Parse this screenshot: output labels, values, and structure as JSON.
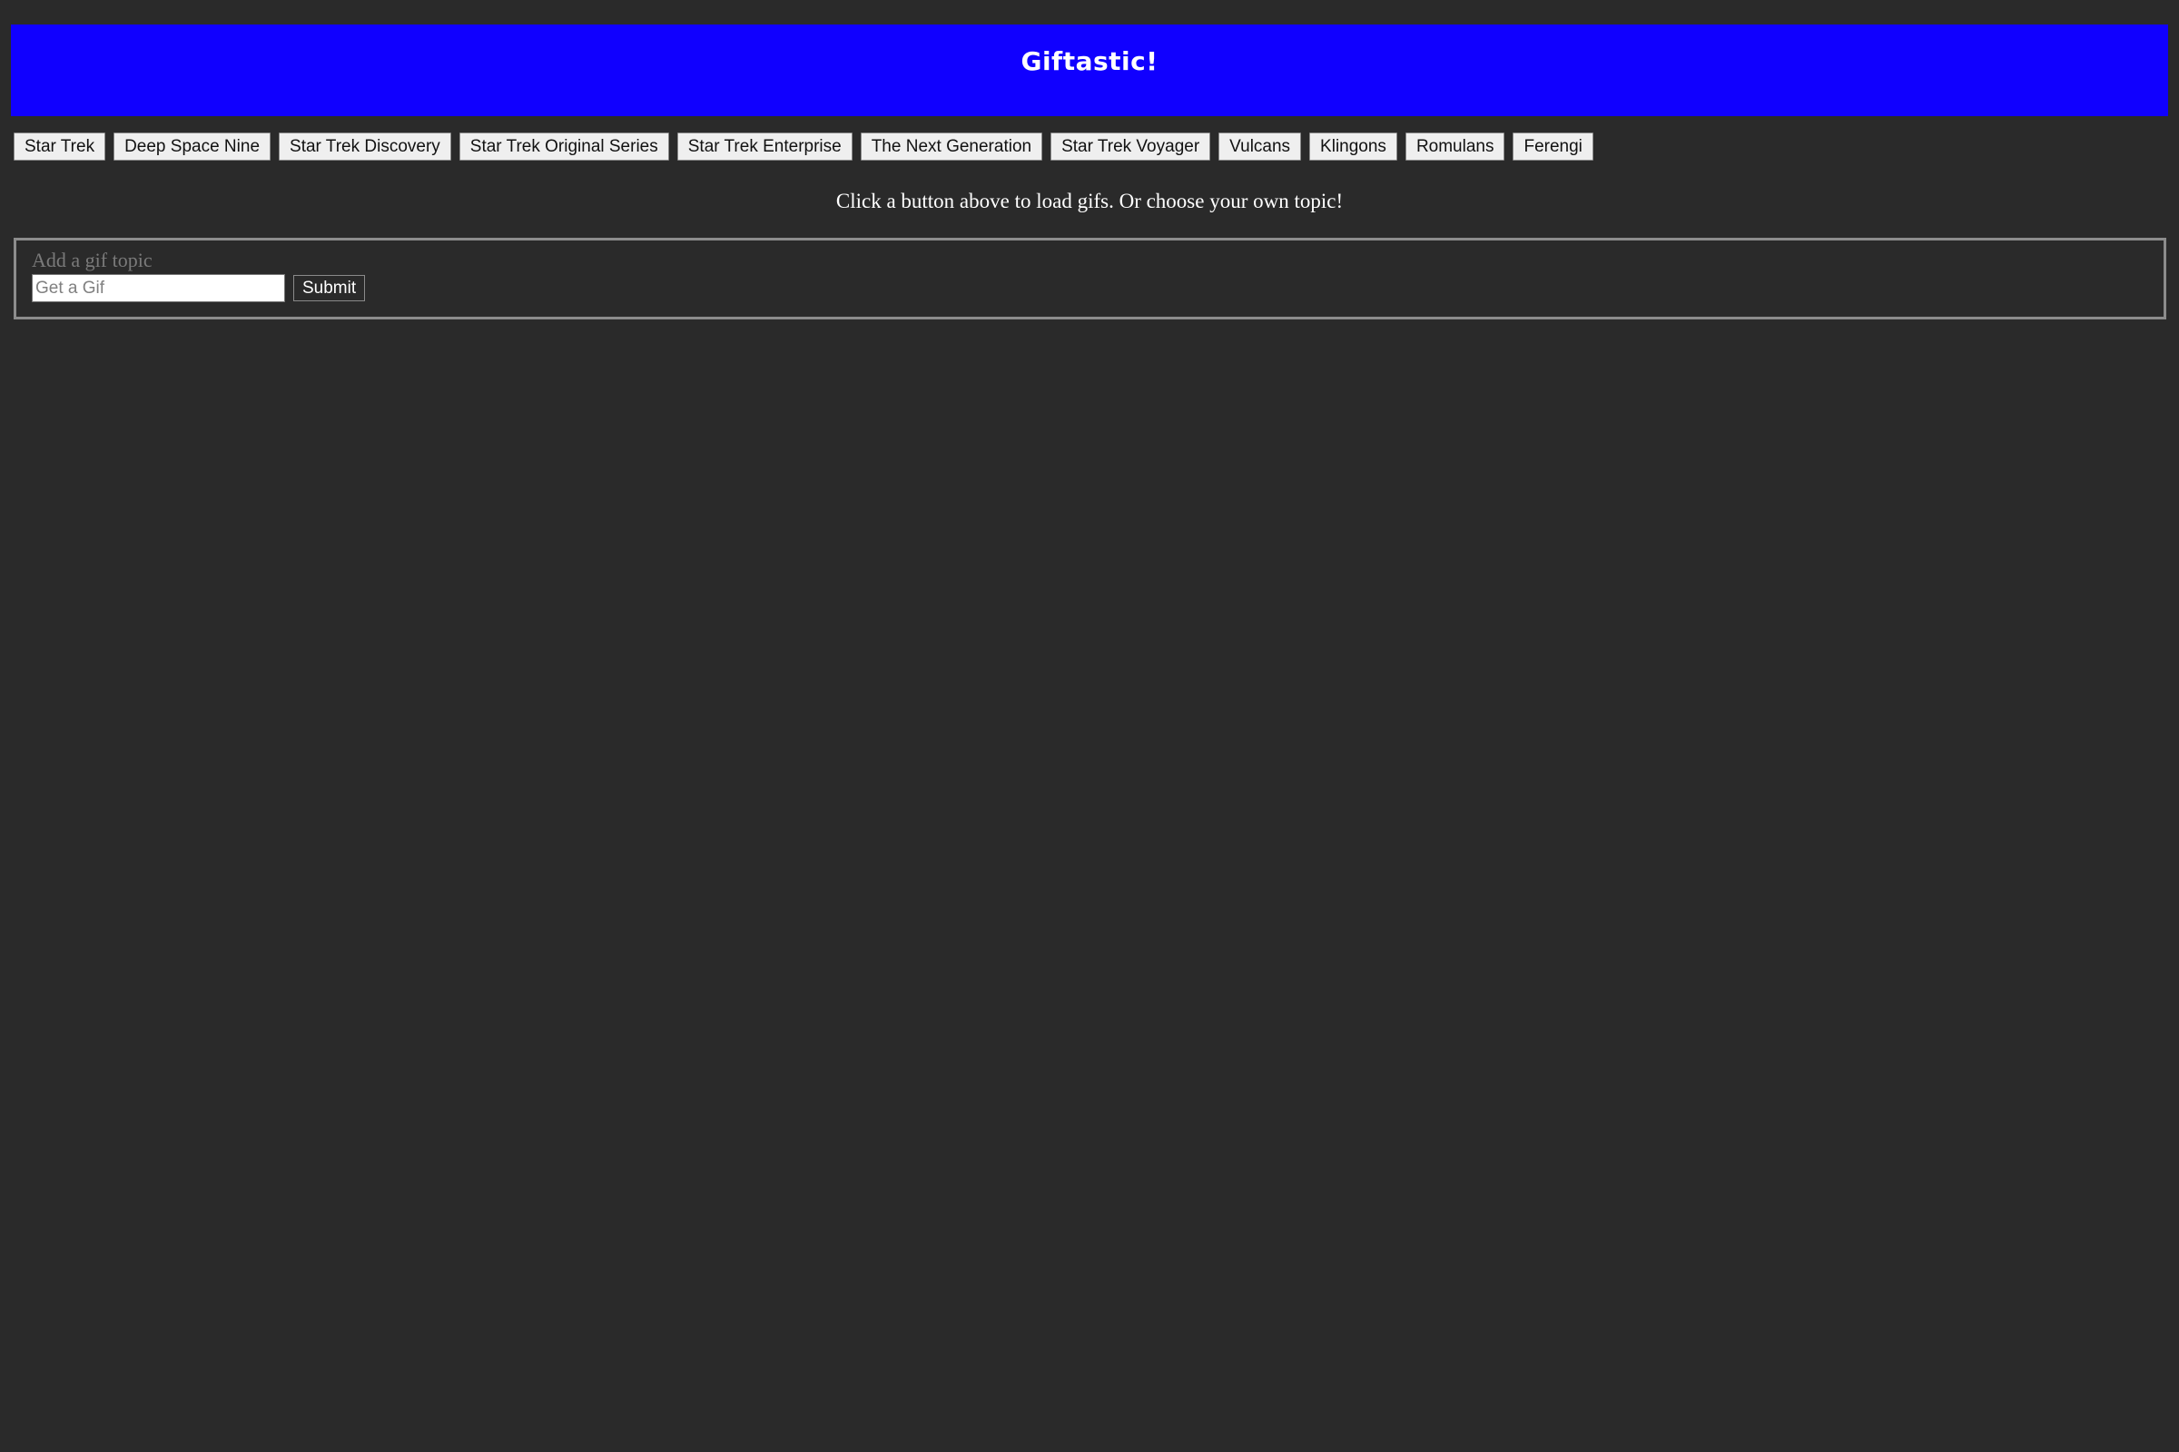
{
  "header": {
    "title": "Giftastic!"
  },
  "topics": [
    "Star Trek",
    "Deep Space Nine",
    "Star Trek Discovery",
    "Star Trek Original Series",
    "Star Trek Enterprise",
    "The Next Generation",
    "Star Trek Voyager",
    "Vulcans",
    "Klingons",
    "Romulans",
    "Ferengi"
  ],
  "main": {
    "instructions": "Click a button above to load gifs. Or choose your own topic!"
  },
  "form": {
    "label": "Add a gif topic",
    "input_value": "",
    "input_placeholder": "Get a Gif",
    "submit_label": "Submit"
  },
  "colors": {
    "background": "#2a2a2a",
    "header_bg": "#1000ff"
  }
}
